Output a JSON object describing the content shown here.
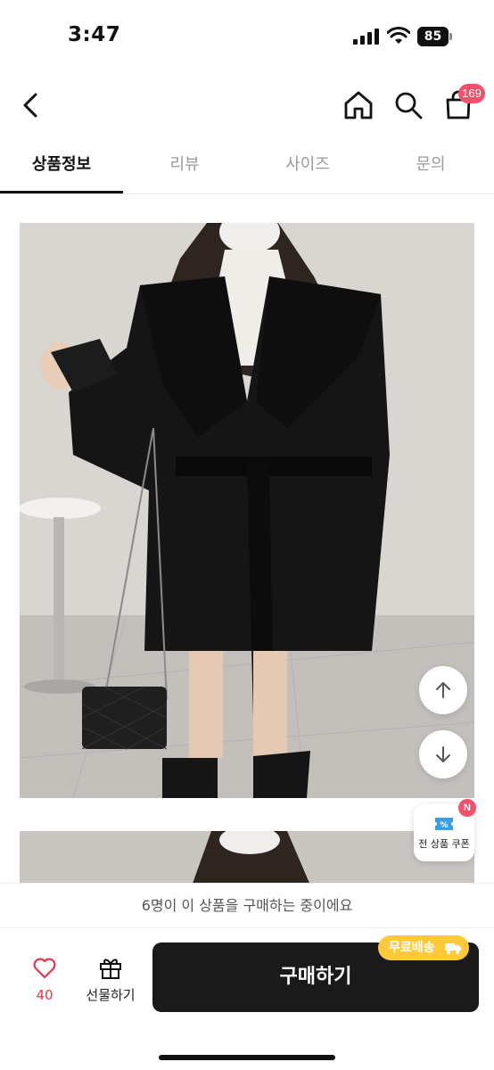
{
  "status_bar": {
    "time": "3:47",
    "battery": "85"
  },
  "nav": {
    "back_icon": "chevron-left-icon",
    "home_icon": "home-icon",
    "search_icon": "search-icon",
    "cart_icon": "shopping-bag-icon",
    "cart_count": "169"
  },
  "tabs": [
    {
      "label": "상품정보",
      "active": true
    },
    {
      "label": "리뷰",
      "active": false
    },
    {
      "label": "사이즈",
      "active": false
    },
    {
      "label": "문의",
      "active": false
    }
  ],
  "coupon": {
    "label": "전 상품 쿠폰",
    "badge": "N"
  },
  "viewers_notice": "6명이 이 상품을 구매하는 중이에요",
  "bottom_bar": {
    "like_count": "40",
    "gift_label": "선물하기",
    "buy_label": "구매하기",
    "shipping_badge": "무료배송"
  },
  "colors": {
    "accent": "#f5506a",
    "buy_button": "#1a1a1a",
    "shipping_badge": "#ffc93a"
  }
}
